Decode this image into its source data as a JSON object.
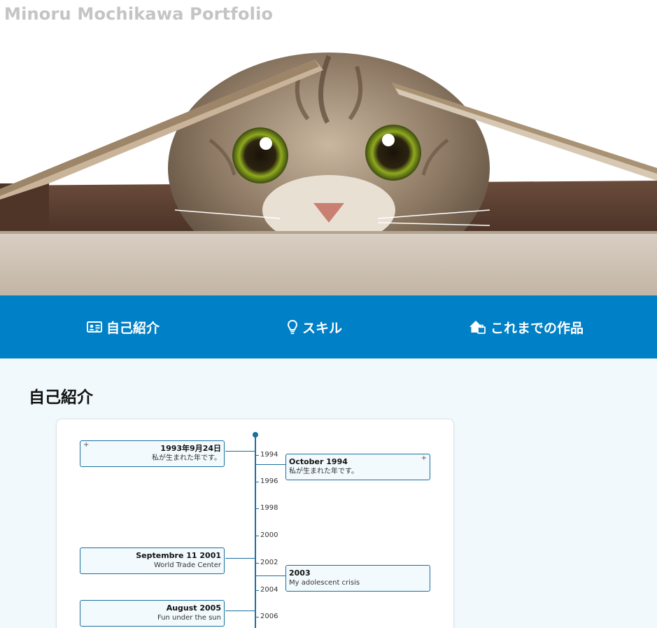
{
  "site": {
    "title": "Minoru Mochikawa Portfolio"
  },
  "hero": {
    "image": "cat peeking out of a cardboard box"
  },
  "nav": {
    "items": [
      {
        "label": "自己紹介",
        "icon": "id-card-icon"
      },
      {
        "label": "スキル",
        "icon": "lightbulb-icon"
      },
      {
        "label": "これまでの作品",
        "icon": "house-work-icon"
      }
    ]
  },
  "main": {
    "section_title": "自己紹介",
    "timeline": {
      "ticks": [
        "1994",
        "1996",
        "1998",
        "2000",
        "2002",
        "2004",
        "2006"
      ],
      "events": [
        {
          "title": "1993年9月24日",
          "desc": "私が生まれた年です。",
          "side": "left",
          "expandable": "+"
        },
        {
          "title": "October 1994",
          "desc": "私が生まれた年です。",
          "side": "right",
          "expandable": "+"
        },
        {
          "title": "Septembre 11 2001",
          "desc": "World Trade Center",
          "side": "left"
        },
        {
          "title": "2003",
          "desc": "My adolescent crisis",
          "side": "right"
        },
        {
          "title": "August 2005",
          "desc": "Fun under the sun",
          "side": "left"
        }
      ]
    }
  },
  "colors": {
    "nav_bg": "#0080c6",
    "section_bg": "#f1f9fc",
    "timeline_line": "#1b6f9e",
    "title_gray": "#c4c4c4"
  }
}
